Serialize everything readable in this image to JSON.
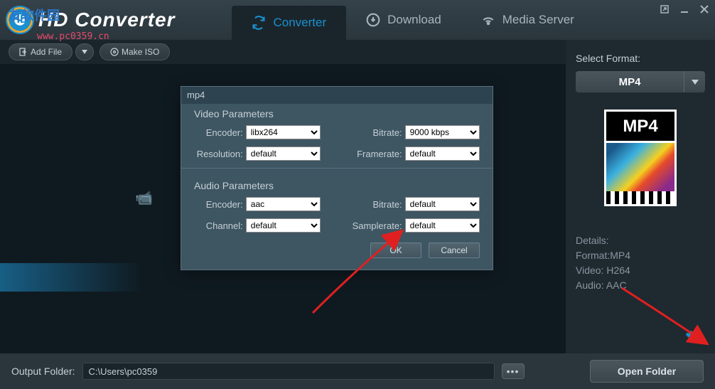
{
  "app": {
    "title": "HD Converter",
    "url_watermark": "www.pc0359.cn",
    "cn_overlay": "友软件园"
  },
  "tabs": {
    "converter": "Converter",
    "download": "Download",
    "media_server": "Media Server"
  },
  "toolbar": {
    "add_file": "Add File",
    "make_iso": "Make ISO"
  },
  "sidebar": {
    "select_format_label": "Select Format:",
    "format": "MP4",
    "thumb_label": "MP4",
    "details_label": "Details:",
    "detail_format": "Format:MP4",
    "detail_video": "Video: H264",
    "detail_audio": "Audio: AAC"
  },
  "dialog": {
    "title": "mp4",
    "video_section": "Video Parameters",
    "audio_section": "Audio Parameters",
    "video": {
      "encoder_label": "Encoder:",
      "encoder_value": "libx264",
      "bitrate_label": "Bitrate:",
      "bitrate_value": "9000 kbps",
      "resolution_label": "Resolution:",
      "resolution_value": "default",
      "framerate_label": "Framerate:",
      "framerate_value": "default"
    },
    "audio": {
      "encoder_label": "Encoder:",
      "encoder_value": "aac",
      "bitrate_label": "Bitrate:",
      "bitrate_value": "default",
      "channel_label": "Channel:",
      "channel_value": "default",
      "samplerate_label": "Samplerate:",
      "samplerate_value": "default"
    },
    "ok": "OK",
    "cancel": "Cancel"
  },
  "footer": {
    "label": "Output Folder:",
    "path": "C:\\Users\\pc0359",
    "open_folder": "Open Folder"
  }
}
